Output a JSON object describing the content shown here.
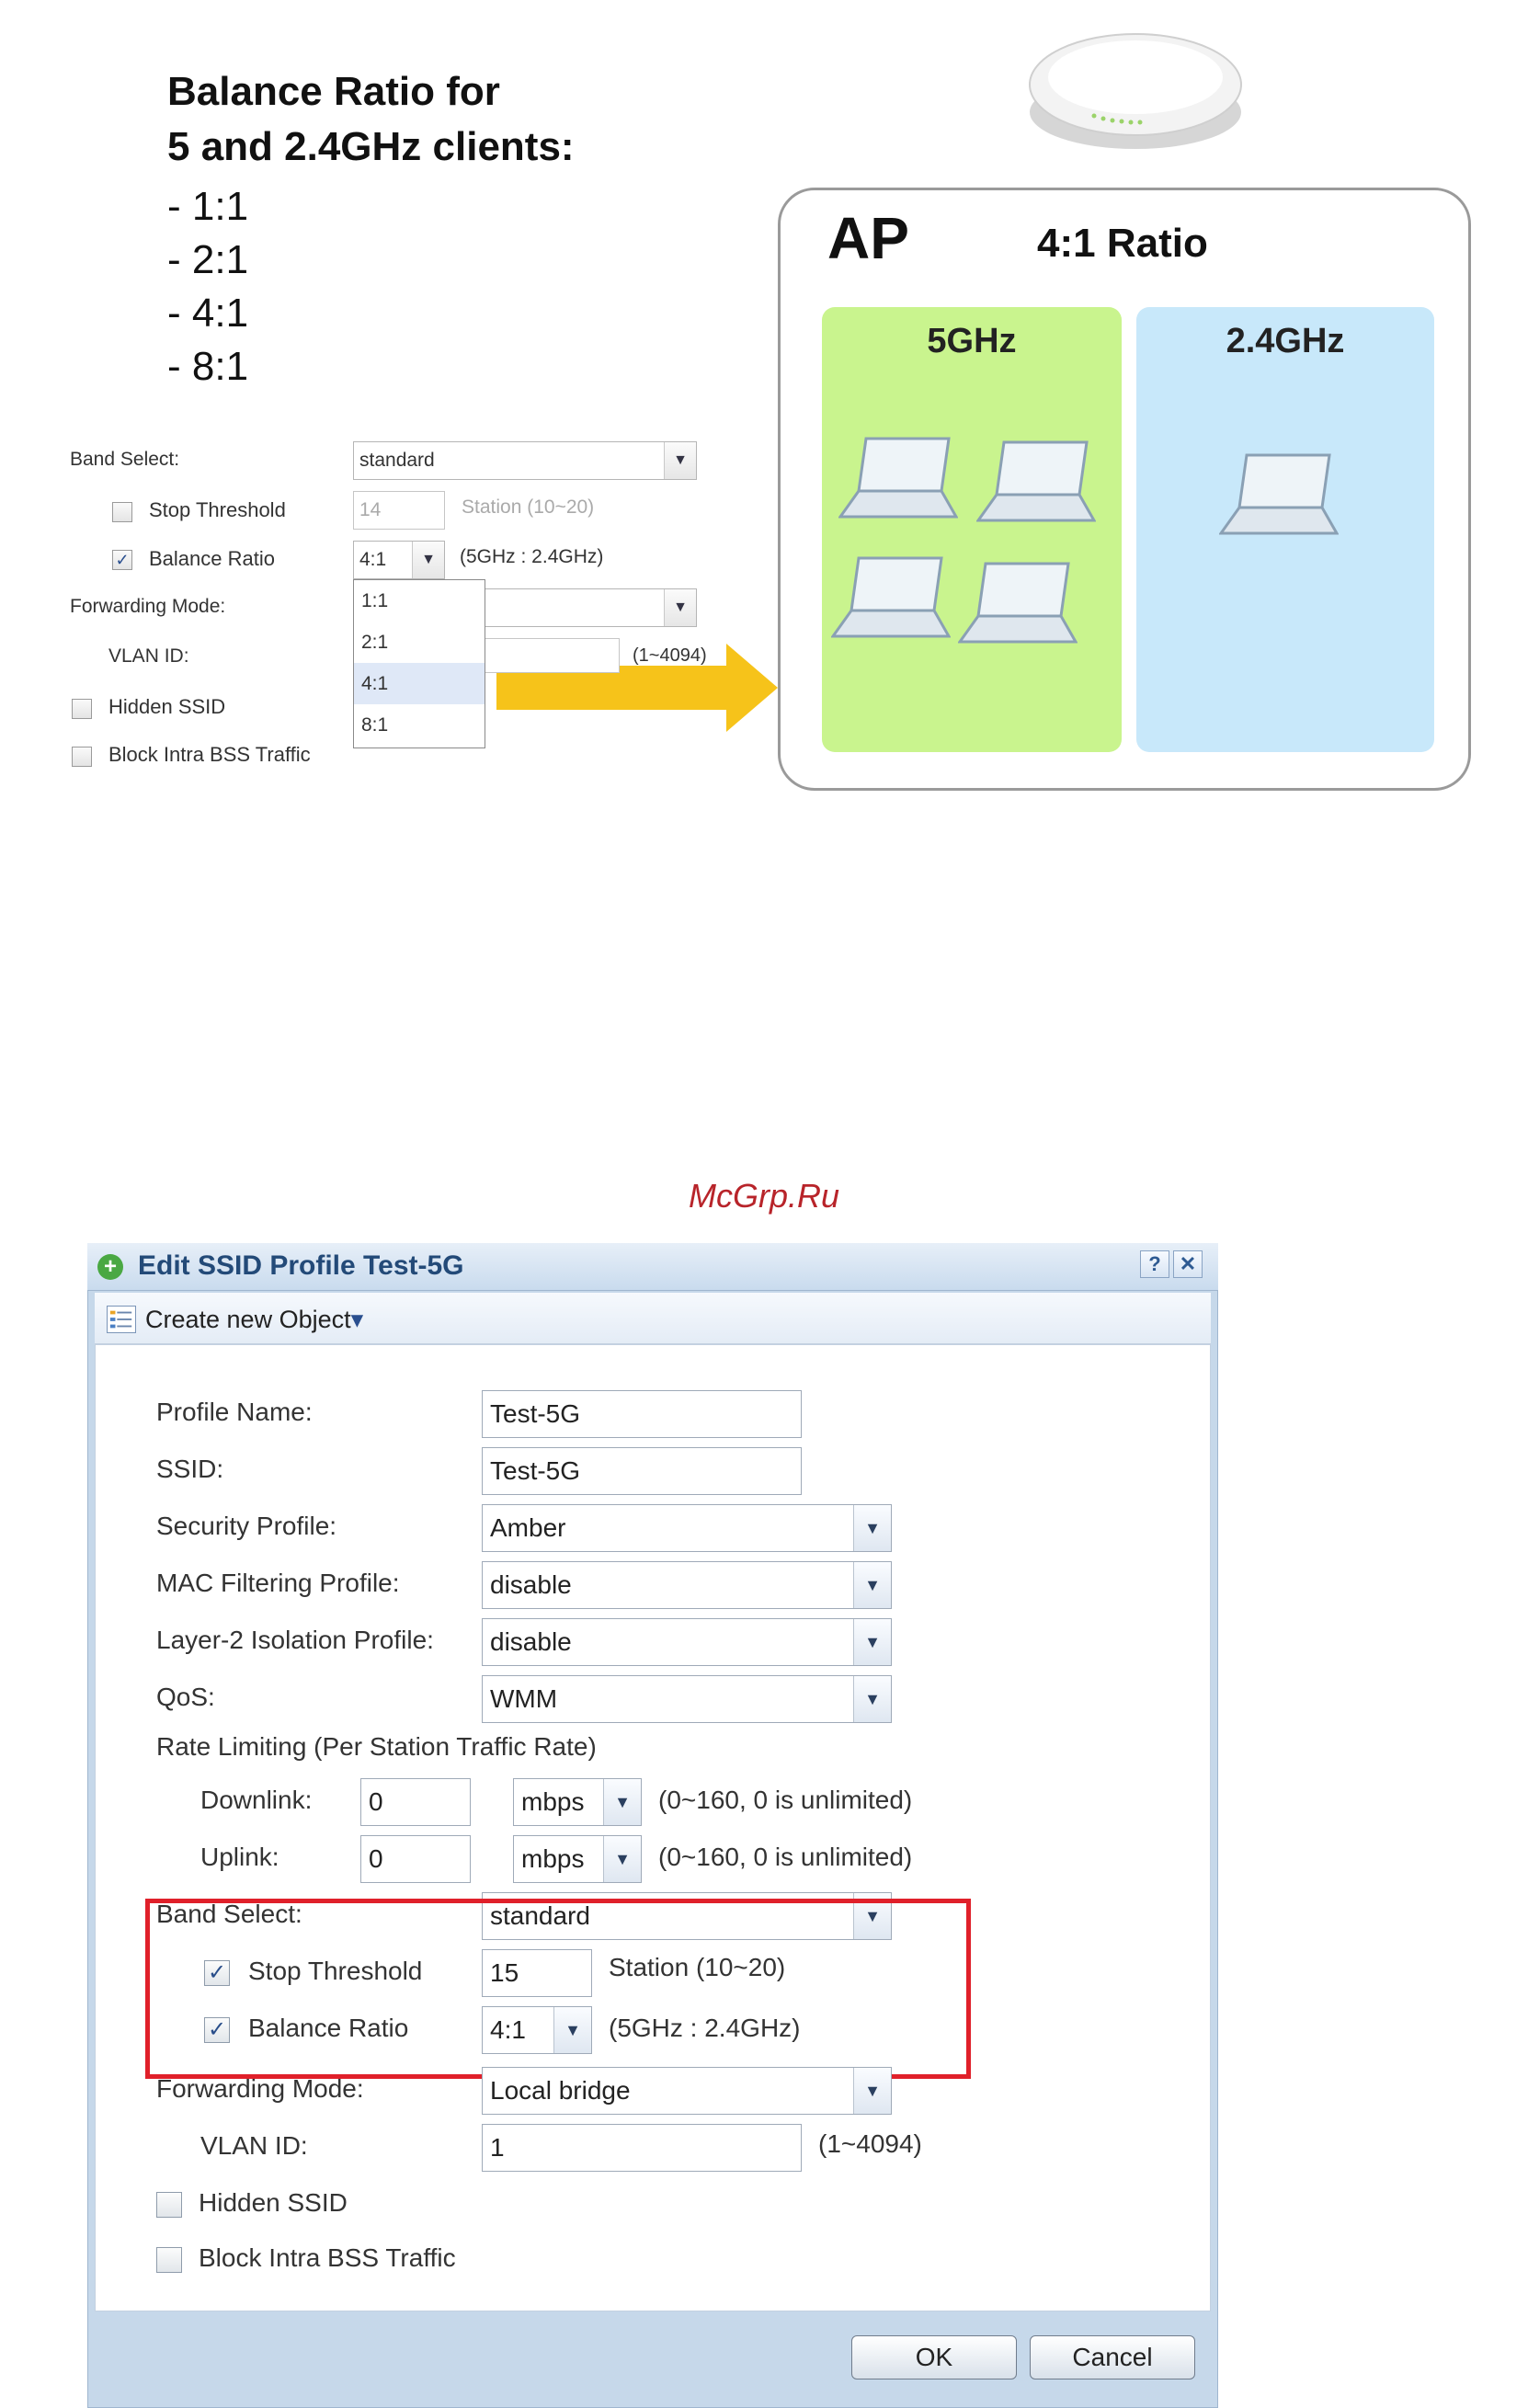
{
  "illustration": {
    "title_line1": "Balance Ratio for",
    "title_line2": "5 and 2.4GHz clients:",
    "ratios": [
      "- 1:1",
      "- 2:1",
      "- 4:1",
      "- 8:1"
    ],
    "ap_label": "AP",
    "ap_ratio": "4:1 Ratio",
    "band_5": "5GHz",
    "band_24": "2.4GHz",
    "colors": {
      "band_5": "#c9f48e",
      "band_24": "#c8e8fa",
      "arrow": "#f6c31a"
    }
  },
  "small_form": {
    "band_select_label": "Band Select:",
    "band_select_value": "standard",
    "stop_threshold_label": "Stop Threshold",
    "stop_threshold_value": "14",
    "stop_threshold_hint": "Station (10~20)",
    "balance_ratio_label": "Balance Ratio",
    "balance_ratio_value": "4:1",
    "balance_ratio_hint": "(5GHz : 2.4GHz)",
    "forwarding_mode_label": "Forwarding Mode:",
    "vlan_id_label": "VLAN ID:",
    "vlan_hint": "(1~4094)",
    "hidden_ssid_label": "Hidden SSID",
    "block_intra_label": "Block Intra BSS Traffic",
    "ratio_options": [
      "1:1",
      "2:1",
      "4:1",
      "8:1"
    ]
  },
  "watermark": "McGrp.Ru",
  "dialog": {
    "title": "Edit SSID Profile Test-5G",
    "help_label": "?",
    "close_label": "✕",
    "toolbar_create": "Create new Object",
    "toolbar_caret": "▾",
    "fields": {
      "profile_name_label": "Profile Name:",
      "profile_name_value": "Test-5G",
      "ssid_label": "SSID:",
      "ssid_value": "Test-5G",
      "security_label": "Security Profile:",
      "security_value": "Amber",
      "mac_label": "MAC Filtering Profile:",
      "mac_value": "disable",
      "layer2_label": "Layer-2 Isolation Profile:",
      "layer2_value": "disable",
      "qos_label": "QoS:",
      "qos_value": "WMM",
      "rate_label": "Rate Limiting (Per Station Traffic Rate)",
      "downlink_label": "Downlink:",
      "downlink_value": "0",
      "downlink_unit": "mbps",
      "downlink_hint": "(0~160, 0 is unlimited)",
      "uplink_label": "Uplink:",
      "uplink_value": "0",
      "uplink_unit": "mbps",
      "uplink_hint": "(0~160, 0 is unlimited)",
      "band_select_label": "Band Select:",
      "band_select_value": "standard",
      "stop_threshold_label": "Stop Threshold",
      "stop_threshold_value": "15",
      "stop_threshold_hint": "Station (10~20)",
      "balance_ratio_label": "Balance Ratio",
      "balance_ratio_value": "4:1",
      "balance_ratio_hint": "(5GHz : 2.4GHz)",
      "forwarding_label": "Forwarding Mode:",
      "forwarding_value": "Local bridge",
      "vlan_label": "VLAN ID:",
      "vlan_value": "1",
      "vlan_hint": "(1~4094)",
      "hidden_ssid_label": "Hidden SSID",
      "block_intra_label": "Block Intra BSS Traffic"
    },
    "ok_label": "OK",
    "cancel_label": "Cancel",
    "check_mark": "✓",
    "dropdown_glyph": "▼"
  }
}
